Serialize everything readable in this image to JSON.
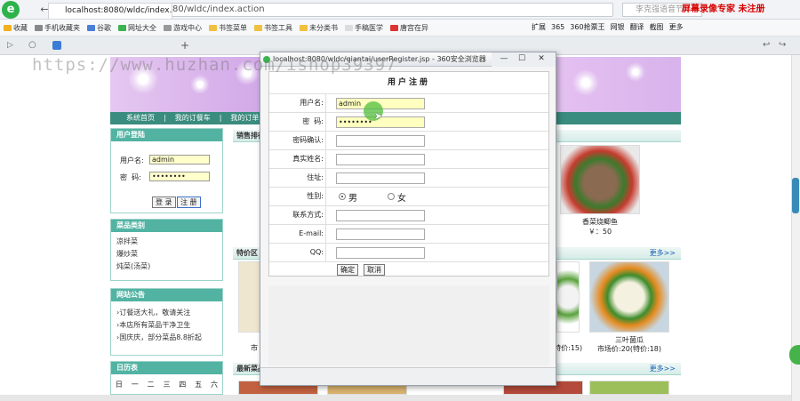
{
  "browser": {
    "logo_letter": "e",
    "url": "localhost:8080/wldc/index.action",
    "search_placeholder": "李克强语音节...",
    "register_warning": "屏幕录像专家  未注册",
    "tab_title": "localhost:8080/wldc/index.ac",
    "new_tab": "+",
    "bookmarks": [
      "收藏",
      "手机收藏夹",
      "谷歌",
      "网址大全",
      "游戏中心",
      "书签菜单",
      "书签工具",
      "未分类书",
      "手稿医学",
      "唐宫在异"
    ],
    "right_tools": [
      "扩展",
      "365",
      "360抢票王",
      "网银",
      "翻译",
      "截图",
      "更多"
    ]
  },
  "watermark": "https://www.huzhan.com/ishop39397",
  "site": {
    "nav": [
      "系统首页",
      "我的订餐车",
      "我的订单"
    ],
    "login": {
      "head": "用户登陆",
      "user_label": "用户名:",
      "user_value": "admin",
      "pwd_label": "密  码:",
      "pwd_value": "••••••••",
      "login_btn": "登 录",
      "register_btn": "注 册"
    },
    "categories": {
      "head": "菜品类别",
      "items": [
        "凉拌菜",
        "爆炒菜",
        "炖菜(汤菜)"
      ]
    },
    "notices": {
      "head": "网站公告",
      "items": [
        "订餐送大礼，敬请关注",
        "本店所有菜品干净卫生",
        "国庆庆，部分菜品8.8折起"
      ]
    },
    "calendar": {
      "head": "日历表",
      "days": [
        "日",
        "一",
        "二",
        "三",
        "四",
        "五",
        "六"
      ]
    },
    "sales_head": "销售排行",
    "special_head": "特价区",
    "latest_head": "最新菜品",
    "more": "更多>>",
    "dish1": {
      "name": "香菜烧鲫鱼",
      "price": "￥：50"
    },
    "dish2": {
      "name": "三叶菌瓜",
      "price": "市场价:20(特价:18)"
    },
    "dish_left_caption": "市",
    "dish_mid_caption": "(特价:15)"
  },
  "popup": {
    "title": "localhost:8080/wldc/qiantai/userRegister.jsp - 360安全浏览器",
    "window_buttons": [
      "—",
      "☐",
      "✕"
    ],
    "form_title": "用户注册",
    "fields": [
      {
        "label": "用户名:",
        "value": "admin"
      },
      {
        "label": "密  码:",
        "value": "••••••••"
      },
      {
        "label": "密码确认:",
        "value": ""
      },
      {
        "label": "真实姓名:",
        "value": ""
      },
      {
        "label": "住址:",
        "value": ""
      },
      {
        "label": "性别:",
        "value": ""
      },
      {
        "label": "联系方式:",
        "value": ""
      },
      {
        "label": "E-mail:",
        "value": ""
      },
      {
        "label": "QQ:",
        "value": ""
      }
    ],
    "gender_male": "男",
    "gender_female": "女",
    "submit": "确定",
    "cancel": "取消"
  },
  "colors": {
    "accent": "#52b3a3",
    "nav": "#3a8c7f",
    "banner": "#c89ae3"
  }
}
